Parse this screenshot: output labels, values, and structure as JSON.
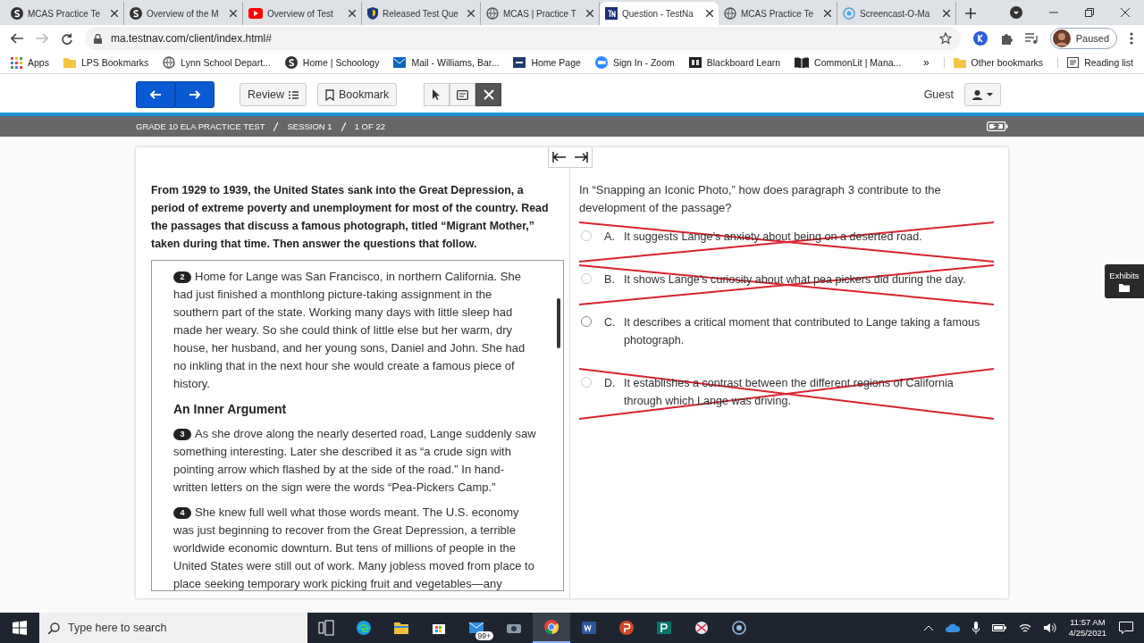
{
  "browser": {
    "tabs": [
      {
        "title": "MCAS Practice Te",
        "kind": "s",
        "selected": false
      },
      {
        "title": "Overview of the M",
        "kind": "s",
        "selected": false
      },
      {
        "title": "Overview of Test",
        "kind": "youtube",
        "selected": false
      },
      {
        "title": "Released Test Que",
        "kind": "shield",
        "selected": false
      },
      {
        "title": "MCAS | Practice T",
        "kind": "globe",
        "selected": false
      },
      {
        "title": "Question - TestNa",
        "kind": "tn",
        "selected": true
      },
      {
        "title": "MCAS Practice Te",
        "kind": "globe",
        "selected": false
      },
      {
        "title": "Screencast-O-Ma",
        "kind": "ring",
        "selected": false
      }
    ],
    "address": "ma.testnav.com/client/index.html#",
    "profile": "Paused",
    "bookmarks": [
      {
        "label": "Apps",
        "kind": "grid"
      },
      {
        "label": "LPS Bookmarks",
        "kind": "folder"
      },
      {
        "label": "Lynn School Depart...",
        "kind": "globe"
      },
      {
        "label": "Home | Schoology",
        "kind": "s"
      },
      {
        "label": "Mail - Williams, Bar...",
        "kind": "mail"
      },
      {
        "label": "Home Page",
        "kind": "tac"
      },
      {
        "label": "Sign In - Zoom",
        "kind": "zoom"
      },
      {
        "label": "Blackboard Learn",
        "kind": "bb"
      },
      {
        "label": "CommonLit | Mana...",
        "kind": "book"
      }
    ],
    "more": "»",
    "other": "Other bookmarks",
    "reading": "Reading list"
  },
  "toolbar": {
    "review": "Review",
    "bookmark": "Bookmark",
    "tools": [
      {
        "kind": "pointer",
        "selected": false
      },
      {
        "kind": "note",
        "selected": false
      },
      {
        "kind": "eliminate",
        "selected": true
      }
    ],
    "user": "Guest"
  },
  "breadcrumb": [
    "GRADE 10 ELA PRACTICE TEST",
    "SESSION 1",
    "1 OF 22"
  ],
  "intro": "From 1929 to 1939, the United States sank into the Great Depression, a period of extreme poverty and unemployment for most of the country. Read the passages that discuss a famous photograph, titled “Migrant Mother,” taken during that time. Then answer the questions that follow.",
  "passage": [
    {
      "kind": "paragraph",
      "number": "2",
      "text": "Home for Lange was San Francisco, in northern California. She had just finished a monthlong picture-taking assignment in the southern part of the state. Working many days with little sleep had made her weary. So she could think of little else but her warm, dry house, her husband, and her young sons, Daniel and John. She had no inkling that in the next hour she would create a famous piece of history."
    },
    {
      "kind": "heading",
      "text": "An Inner Argument"
    },
    {
      "kind": "paragraph",
      "number": "3",
      "text": "As she drove along the nearly deserted road, Lange suddenly saw something interesting. Later she described it as “a crude sign with pointing arrow which flashed by at the side of the road.” In hand-written letters on the sign were the words “Pea-Pickers Camp.”"
    },
    {
      "kind": "paragraph",
      "number": "4",
      "text": "She knew full well what those words meant. The U.S. economy was just beginning to recover from the Great Depression, a terrible worldwide economic downturn. But tens of millions of people in the United States were still out of work. Many jobless moved from place to place seeking temporary work picking fruit and vegetables—any"
    }
  ],
  "question": "In “Snapping an Iconic Photo,” how does paragraph 3 contribute to the development of the passage?",
  "choices": [
    {
      "letter": "A.",
      "text": "It suggests Lange’s anxiety about being on a deserted road.",
      "eliminated": true,
      "selected": false
    },
    {
      "letter": "B.",
      "text": "It shows Lange’s curiosity about what pea pickers did during the day.",
      "eliminated": true,
      "selected": false
    },
    {
      "letter": "C.",
      "text": "It describes a critical moment that contributed to Lange taking a famous photograph.",
      "eliminated": false,
      "selected": false
    },
    {
      "letter": "D.",
      "text": "It establishes a contrast between the different regions of California through which Lange was driving.",
      "eliminated": true,
      "selected": false
    }
  ],
  "exhibits": "Exhibits",
  "taskbar": {
    "search": {
      "placeholder": "Type here to search"
    },
    "apps": [
      {
        "kind": "taskview",
        "active": false
      },
      {
        "kind": "edge",
        "active": false
      },
      {
        "kind": "files",
        "active": false
      },
      {
        "kind": "store",
        "active": false
      },
      {
        "kind": "mail",
        "active": false,
        "badge": "99+"
      },
      {
        "kind": "camera",
        "active": false
      },
      {
        "kind": "chrome",
        "active": true
      },
      {
        "kind": "word",
        "active": false
      },
      {
        "kind": "powerpoint",
        "active": false
      },
      {
        "kind": "publisher",
        "active": false
      },
      {
        "kind": "snip",
        "active": false
      },
      {
        "kind": "ring",
        "active": false
      }
    ],
    "time": "11:57 AM",
    "date": "4/25/2021"
  }
}
